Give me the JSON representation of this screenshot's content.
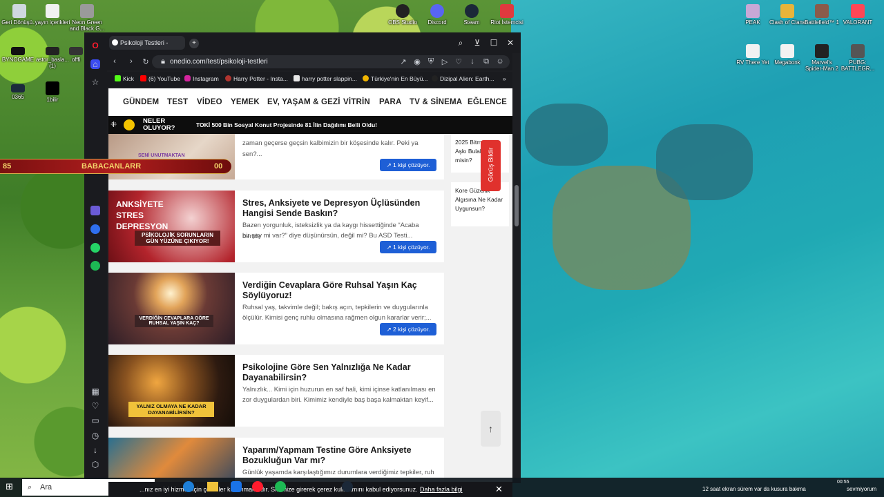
{
  "desktop": {
    "icons_left": [
      {
        "label": "Geri Dönüşü..."
      },
      {
        "label": "yayın içerikleri"
      },
      {
        "label": "Neon Green and Black G..."
      },
      {
        "label": "BYNOGAME"
      },
      {
        "label": "astor_basla... (1)"
      },
      {
        "label": "offfi"
      },
      {
        "label": "0365"
      },
      {
        "label": "1bilir"
      }
    ],
    "icons_top": [
      {
        "label": "OBS Studio"
      },
      {
        "label": "Discord"
      },
      {
        "label": "Steam"
      },
      {
        "label": "Riot İstemcisi"
      }
    ],
    "icons_right": [
      {
        "label": "PEAK"
      },
      {
        "label": "Clash of Clans"
      },
      {
        "label": "Battlefield™ 1"
      },
      {
        "label": "VALORANT"
      },
      {
        "label": "RV There Yet"
      },
      {
        "label": "Megabonk"
      },
      {
        "label": "Marvel's Spider-Man 2"
      },
      {
        "label": "PUBG: BATTLEGR..."
      }
    ],
    "overlay": {
      "left_number": "85",
      "name": "BABACANLARR",
      "right_number": "00"
    }
  },
  "browser": {
    "tab_title": "Psikoloji Testleri - Onedio",
    "url": "onedio.com/test/psikoloji-testleri",
    "bookmarks": [
      "Kick",
      "(6) YouTube",
      "Instagram",
      "Harry Potter - Insta...",
      "harry potter slappin...",
      "Türkiye'nin En Büyü...",
      "Dizipal Alien: Earth..."
    ],
    "menu": [
      "GÜNDEM",
      "TEST",
      "VİDEO",
      "YEMEK",
      "EV, YAŞAM & GEZİ",
      "VİTRİN",
      "PARA",
      "TV & SİNEMA",
      "EĞLENCE"
    ],
    "ticker": {
      "label": "NELER OLUYOR?",
      "headline": "TOKİ 500 Bin Sosyal Konut Projesinde 81 İlin Dağılımı Belli Oldu!"
    },
    "feedback_label": "Görüş Bildir",
    "cards": [
      {
        "title": "",
        "desc_line1": "...",
        "desc_line2": "zaman geçerse geçsin kalbimizin bir köşesinde kalır. Peki ya sen?...",
        "badge": "1 kişi çözüyor.",
        "thumb_text": "SENİ UNUTMAKTAN"
      },
      {
        "title": "Stres, Anksiyete ve Depresyon Üçlüsünden Hangisi Sende Baskın?",
        "desc_line1": "Bazen yorgunluk, isteksizlik ya da kaygı hissettiğinde “Acaba bende",
        "desc_line2": "bir şey mi var?” diye düşünürsün, değil mi? Bu ASD Testi...",
        "badge": "1 kişi çözüyor.",
        "thumb_text": "ANKSİYETE STRES DEPRESYON",
        "thumb_sub": "PSİKOLOJİK SORUNLARIN GÜN YÜZÜNE ÇIKIYOR!"
      },
      {
        "title": "Verdiğin Cevaplara Göre Ruhsal Yaşın Kaç Söylüyoruz!",
        "desc_line1": "Ruhsal yaş, takvimle değil; bakış açın, tepkilerin ve duygularınla",
        "desc_line2": "ölçülür. Kimisi genç ruhlu olmasına rağmen olgun kararlar verir;...",
        "badge": "2 kişi çözüyor.",
        "thumb_text": "VERDİĞİN CEVAPLARA GÖRE RUHSAL YAŞIN KAÇ?"
      },
      {
        "title": "Psikolojine Göre Sen Yalnızlığa Ne Kadar Dayanabilirsin?",
        "desc_line1": "Yalnızlık... Kimi için huzurun en saf hali, kimi içinse katlanılması en",
        "desc_line2": "zor duygulardan biri. Kimimiz kendiyle baş başa kalmaktan keyif...",
        "badge": "",
        "thumb_text": "YALNIZ OLMAYA NE KADAR DAYANABİLİRSİN?"
      },
      {
        "title": "Yaparım/Yapmam Testine Göre Anksiyete Bozukluğun Var mı?",
        "desc_line1": "Günlük yaşamda karşılaştığımız durumlara verdiğimiz tepkiler, ruh",
        "desc_line2": "",
        "badge": "",
        "thumb_text": ""
      }
    ],
    "side_cards": [
      {
        "text": "2025 Bitmeden Aşkı Bulabilecek misin?"
      },
      {
        "text": "Kore Güzellik Algısına Ne Kadar Uygunsun?"
      }
    ],
    "cookie": {
      "text": "...nız en iyi hizmeti için çerezler kullanmaktadır. Sitemize girerek çerez kullanımını kabul ediyorsunuz.",
      "link": "Daha fazla bilgi"
    }
  },
  "taskbar": {
    "search_placeholder": "Ara",
    "chat": "12 saat ekran sürem var da kusura bakma",
    "chat_tail": "sevmiyorum",
    "time": "00:55"
  }
}
